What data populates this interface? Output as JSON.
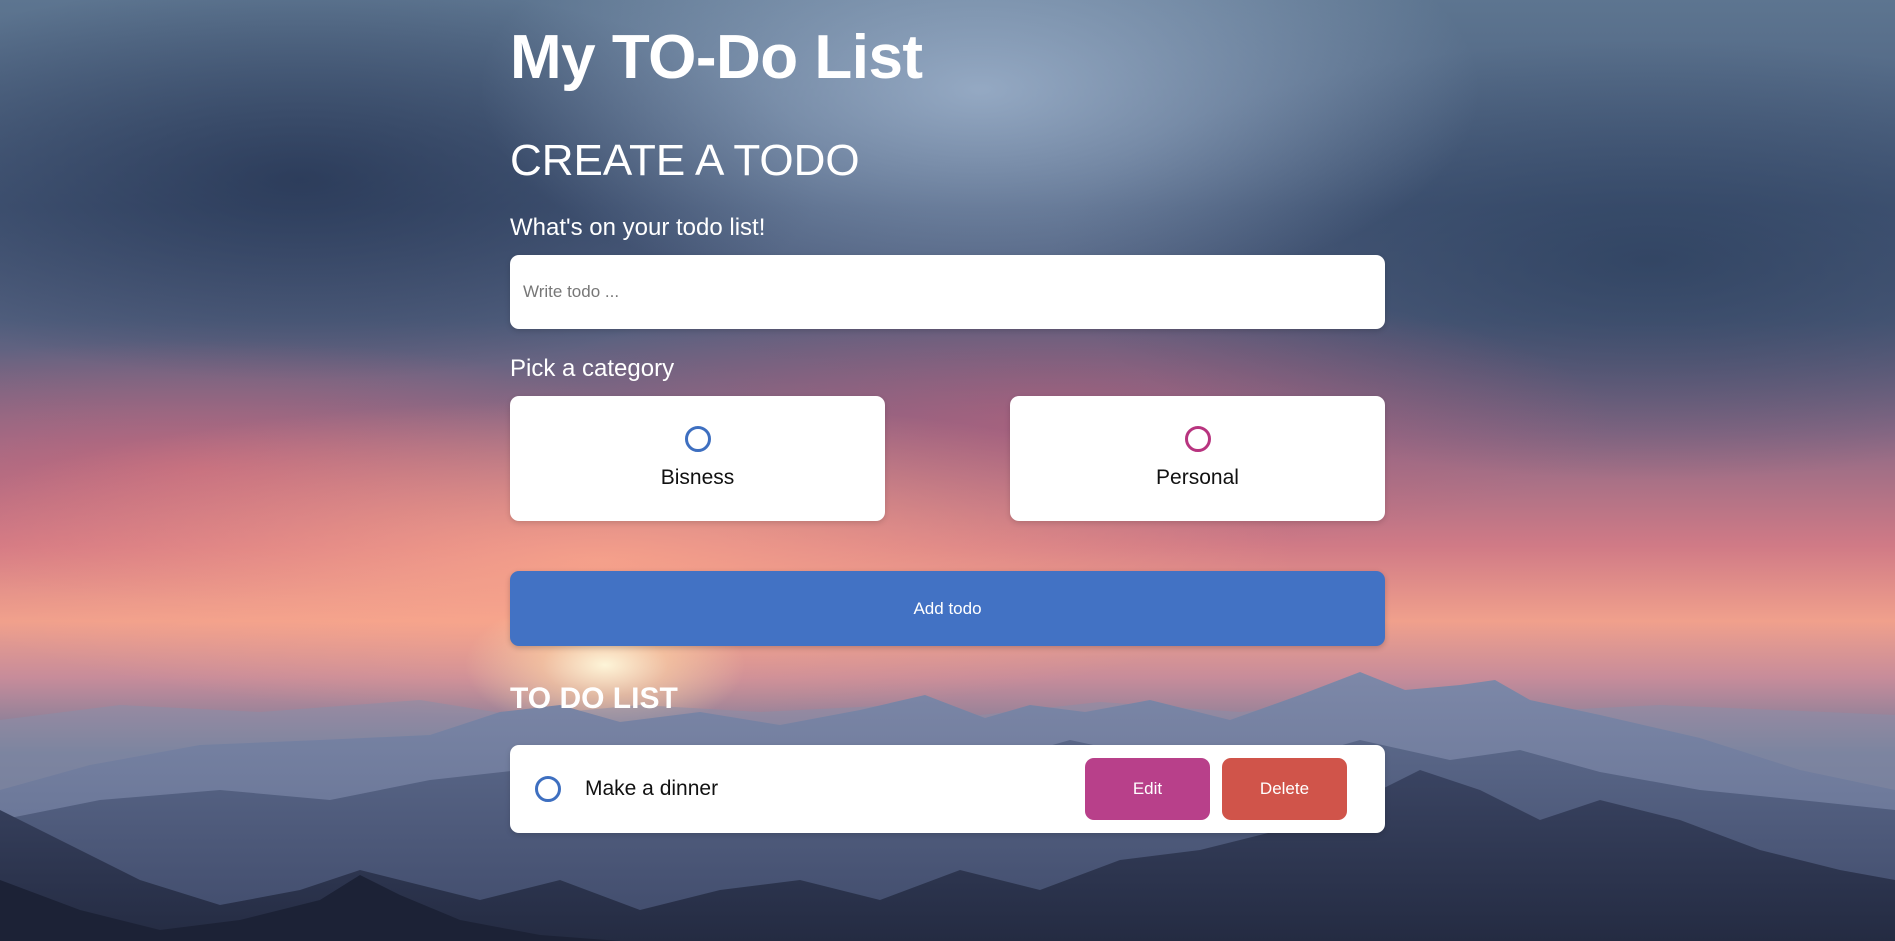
{
  "app": {
    "title": "My TO-Do List"
  },
  "create": {
    "heading": "CREATE A TODO",
    "prompt": "What's on your todo list!",
    "input_placeholder": "Write todo ...",
    "input_value": "",
    "category_label": "Pick a category",
    "categories": [
      {
        "name": "Bisness",
        "color": "#3e6fc0",
        "selected": false
      },
      {
        "name": "Personal",
        "color": "#b8347f",
        "selected": false
      }
    ],
    "add_button_label": "Add todo",
    "add_button_color": "#4272c4"
  },
  "list": {
    "heading": "TO DO LIST",
    "items": [
      {
        "text": "Make a dinner",
        "category_color": "#3e6fc0",
        "done": false,
        "edit_label": "Edit",
        "delete_label": "Delete"
      }
    ]
  },
  "colors": {
    "edit_button": "#b8408a",
    "delete_button": "#d0544a"
  }
}
